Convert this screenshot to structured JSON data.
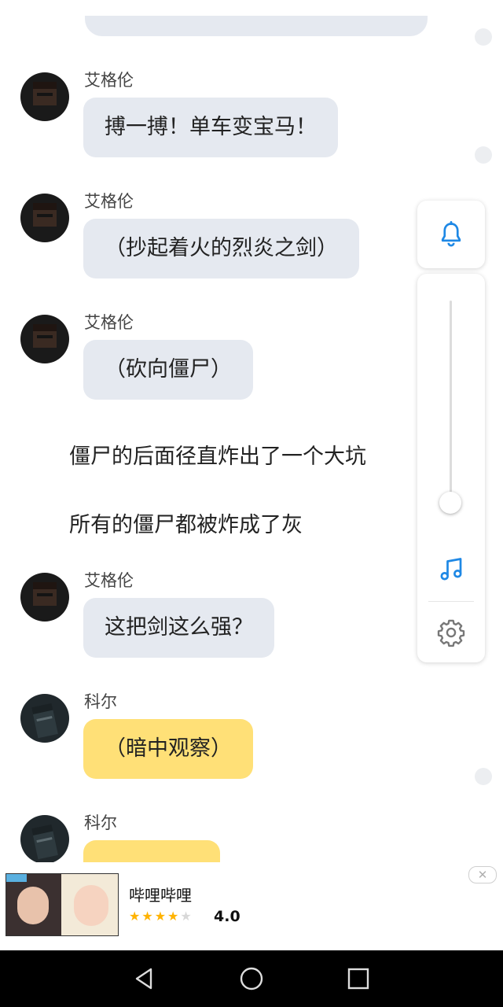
{
  "chat": {
    "messages": [
      {
        "type": "message",
        "name": "艾格伦",
        "text": "搏一搏！单车变宝马！",
        "color": "gray",
        "avatar": "minecraft-steve-avatar"
      },
      {
        "type": "message",
        "name": "艾格伦",
        "text": "（抄起着火的烈炎之剑）",
        "color": "gray",
        "avatar": "minecraft-steve-avatar"
      },
      {
        "type": "message",
        "name": "艾格伦",
        "text": "（砍向僵尸）",
        "color": "gray",
        "avatar": "minecraft-steve-avatar"
      },
      {
        "type": "narration",
        "text": "僵尸的后面径直炸出了一个大坑"
      },
      {
        "type": "narration",
        "text": "所有的僵尸都被炸成了灰"
      },
      {
        "type": "message",
        "name": "艾格伦",
        "text": "这把剑这么强？",
        "color": "gray",
        "avatar": "minecraft-steve-avatar"
      },
      {
        "type": "message",
        "name": "科尔",
        "text": "（暗中观察）",
        "color": "yellow",
        "avatar": "dark-character-avatar"
      },
      {
        "type": "message",
        "name": "科尔",
        "text": "",
        "color": "yellow",
        "avatar": "dark-character-avatar"
      }
    ]
  },
  "controls": {
    "bell_icon": "bell-icon",
    "volume_level": 0.05,
    "music_icon": "music-note-icon",
    "settings_icon": "gear-icon",
    "accent": "#1e88e5"
  },
  "ad": {
    "title": "哔哩哔哩",
    "rating": "4.0",
    "stars_filled": 4,
    "stars_total": 5,
    "close_label": "✕"
  },
  "navbar": {
    "back_icon": "back-triangle-icon",
    "home_icon": "home-circle-icon",
    "recents_icon": "recents-square-icon"
  },
  "colors": {
    "bubble_gray": "#e5e9f0",
    "bubble_yellow": "#ffe077",
    "star": "#ffb300"
  }
}
